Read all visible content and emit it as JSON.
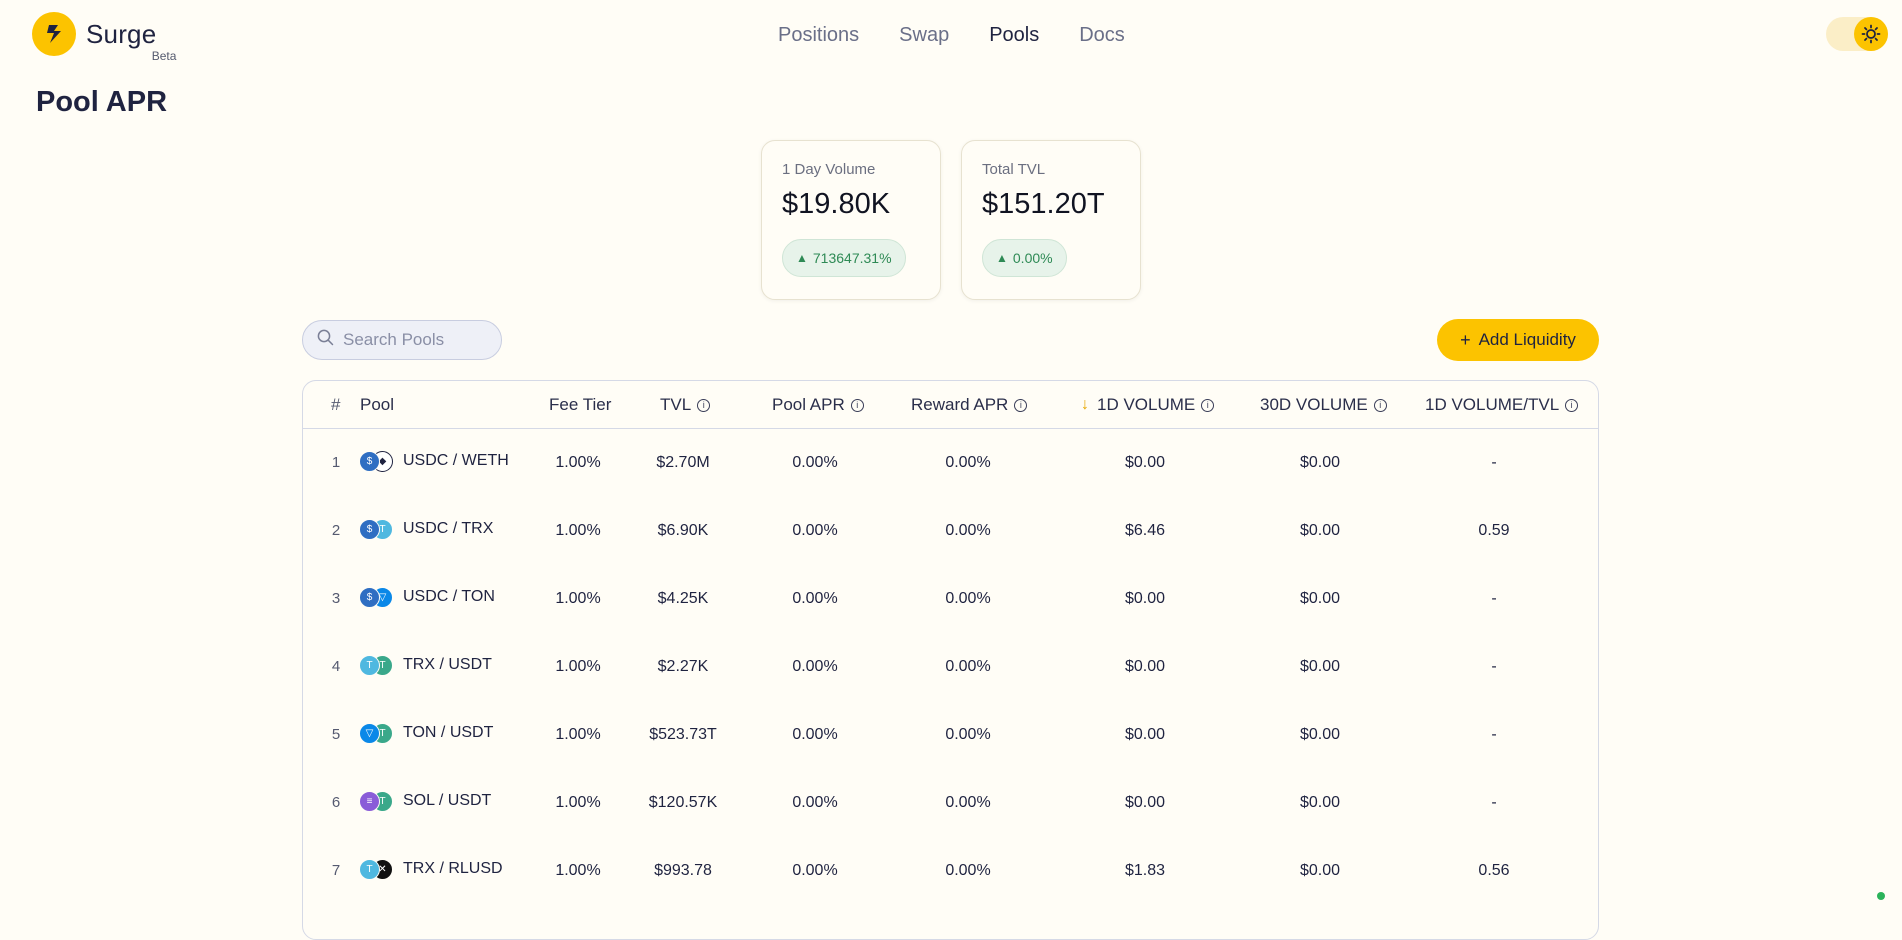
{
  "app": {
    "name": "Surge",
    "badge": "Beta"
  },
  "nav": [
    {
      "label": "Positions",
      "active": false
    },
    {
      "label": "Swap",
      "active": false
    },
    {
      "label": "Pools",
      "active": true
    },
    {
      "label": "Docs",
      "active": false
    }
  ],
  "page_title": "Pool APR",
  "stats": [
    {
      "label": "1 Day Volume",
      "value": "$19.80K",
      "change": "713647.31%"
    },
    {
      "label": "Total TVL",
      "value": "$151.20T",
      "change": "0.00%"
    }
  ],
  "search": {
    "placeholder": "Search Pools",
    "value": ""
  },
  "add_liquidity_label": "Add Liquidity",
  "table": {
    "headers": {
      "index": "#",
      "pool": "Pool",
      "fee": "Fee Tier",
      "tvl": "TVL",
      "pool_apr": "Pool APR",
      "reward_apr": "Reward APR",
      "vol1d": "1D VOLUME",
      "vol30d": "30D VOLUME",
      "vol_tvl": "1D VOLUME/TVL"
    },
    "rows": [
      {
        "index": "1",
        "pool": "USDC / WETH",
        "fee": "1.00%",
        "tvl": "$2.70M",
        "pool_apr": "0.00%",
        "reward_apr": "0.00%",
        "vol1d": "$0.00",
        "vol30d": "$0.00",
        "vol_tvl": "-",
        "tokA": "#2f6ec2",
        "tokB": "#ffffff",
        "glyphA": "$",
        "glyphB": "◆"
      },
      {
        "index": "2",
        "pool": "USDC / TRX",
        "fee": "1.00%",
        "tvl": "$6.90K",
        "pool_apr": "0.00%",
        "reward_apr": "0.00%",
        "vol1d": "$6.46",
        "vol30d": "$0.00",
        "vol_tvl": "0.59",
        "tokA": "#2f6ec2",
        "tokB": "#4fb8e0",
        "glyphA": "$",
        "glyphB": "T"
      },
      {
        "index": "3",
        "pool": "USDC / TON",
        "fee": "1.00%",
        "tvl": "$4.25K",
        "pool_apr": "0.00%",
        "reward_apr": "0.00%",
        "vol1d": "$0.00",
        "vol30d": "$0.00",
        "vol_tvl": "-",
        "tokA": "#2f6ec2",
        "tokB": "#0a88e8",
        "glyphA": "$",
        "glyphB": "▽"
      },
      {
        "index": "4",
        "pool": "TRX / USDT",
        "fee": "1.00%",
        "tvl": "$2.27K",
        "pool_apr": "0.00%",
        "reward_apr": "0.00%",
        "vol1d": "$0.00",
        "vol30d": "$0.00",
        "vol_tvl": "-",
        "tokA": "#4fb8e0",
        "tokB": "#3aa88a",
        "glyphA": "T",
        "glyphB": "T"
      },
      {
        "index": "5",
        "pool": "TON / USDT",
        "fee": "1.00%",
        "tvl": "$523.73T",
        "pool_apr": "0.00%",
        "reward_apr": "0.00%",
        "vol1d": "$0.00",
        "vol30d": "$0.00",
        "vol_tvl": "-",
        "tokA": "#0a88e8",
        "tokB": "#3aa88a",
        "glyphA": "▽",
        "glyphB": "T"
      },
      {
        "index": "6",
        "pool": "SOL / USDT",
        "fee": "1.00%",
        "tvl": "$120.57K",
        "pool_apr": "0.00%",
        "reward_apr": "0.00%",
        "vol1d": "$0.00",
        "vol30d": "$0.00",
        "vol_tvl": "-",
        "tokA": "#8a5cd8",
        "tokB": "#3aa88a",
        "glyphA": "≡",
        "glyphB": "T"
      },
      {
        "index": "7",
        "pool": "TRX / RLUSD",
        "fee": "1.00%",
        "tvl": "$993.78",
        "pool_apr": "0.00%",
        "reward_apr": "0.00%",
        "vol1d": "$1.83",
        "vol30d": "$0.00",
        "vol_tvl": "0.56",
        "tokA": "#4fb8e0",
        "tokB": "#111111",
        "glyphA": "T",
        "glyphB": "✕"
      }
    ]
  }
}
